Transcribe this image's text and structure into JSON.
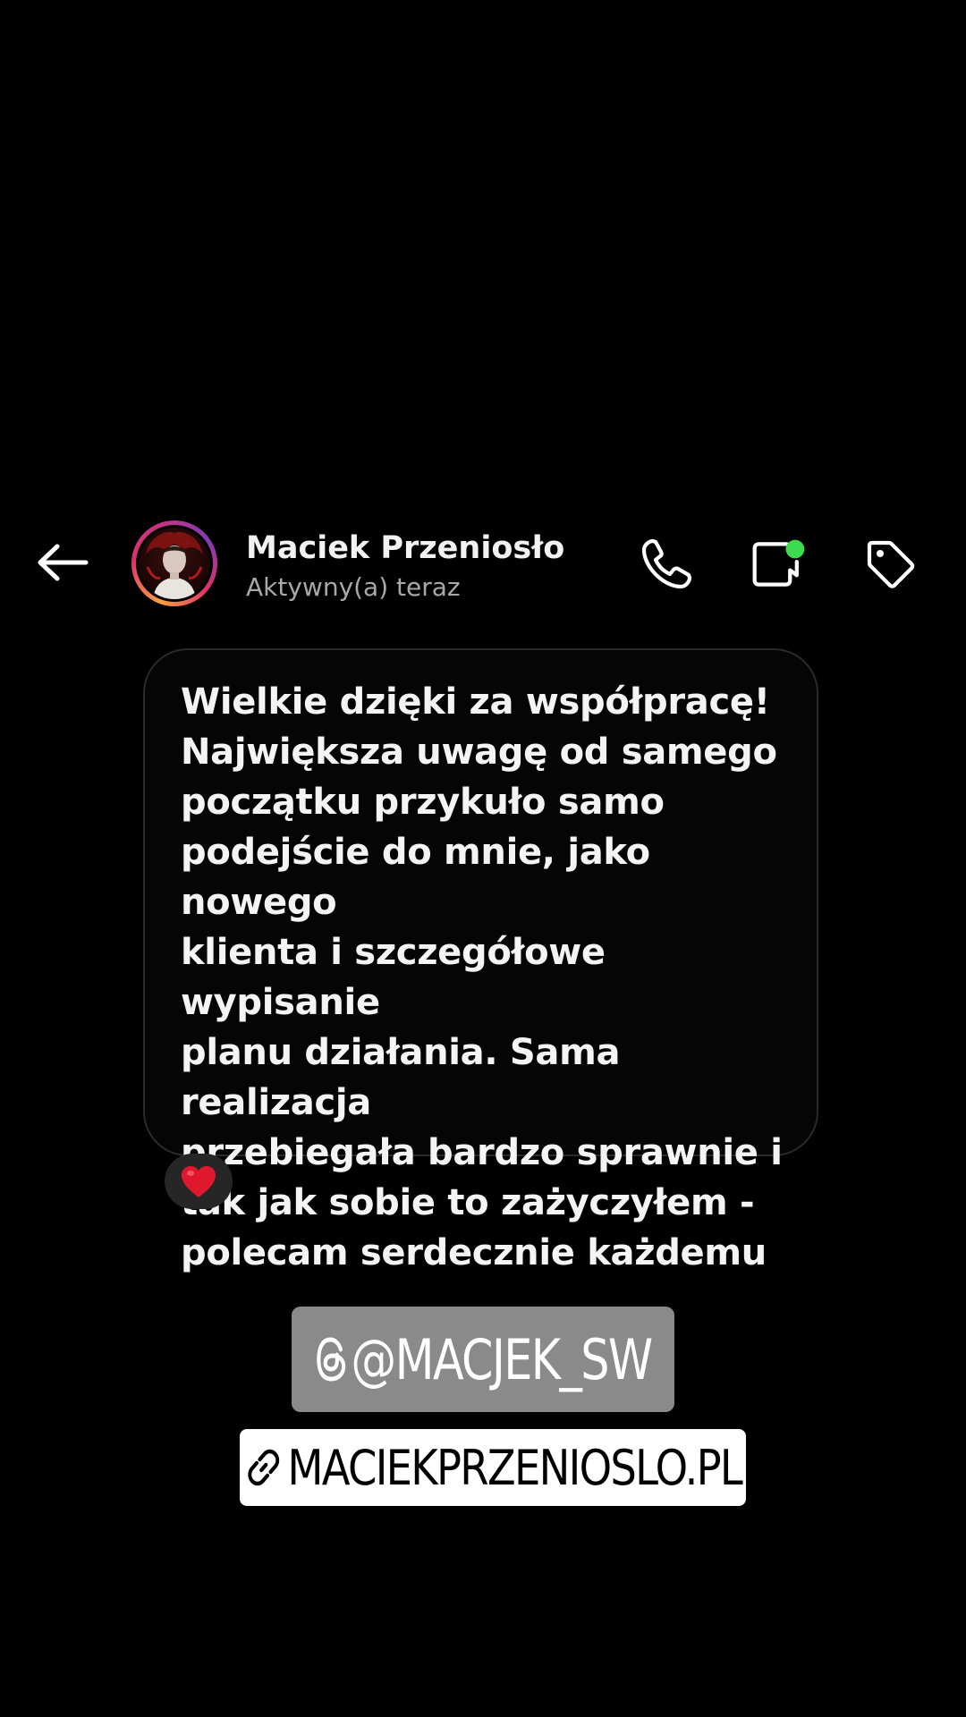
{
  "header": {
    "contact_name": "Maciek Przeniosło",
    "status": "Aktywny(a) teraz"
  },
  "message": {
    "text": "Wielkie dzięki za współpracę!\nNajwiększa uwagę od samego\npoczątku przykuło samo\npodejście do mnie, jako nowego\nklienta i szczegółowe wypisanie\nplanu działania. Sama realizacja\nprzebiegała bardzo sprawnie i\ntak jak sobie to zażyczyłem -\npolecam serdecznie  każdemu",
    "reaction": "❤️"
  },
  "stickers": {
    "mention": "@MACJEK_SW",
    "link": "MACIEKPRZENIOSLO.PL"
  },
  "icons": {
    "back": "arrow-left-icon",
    "call": "phone-icon",
    "video": "video-camera-icon",
    "tag": "tag-icon",
    "threads": "threads-icon",
    "link": "link-icon"
  },
  "colors": {
    "background": "#000000",
    "active_dot": "#3ddc4f",
    "mention_bg": "#8a8a8a",
    "link_bg": "#ffffff"
  }
}
